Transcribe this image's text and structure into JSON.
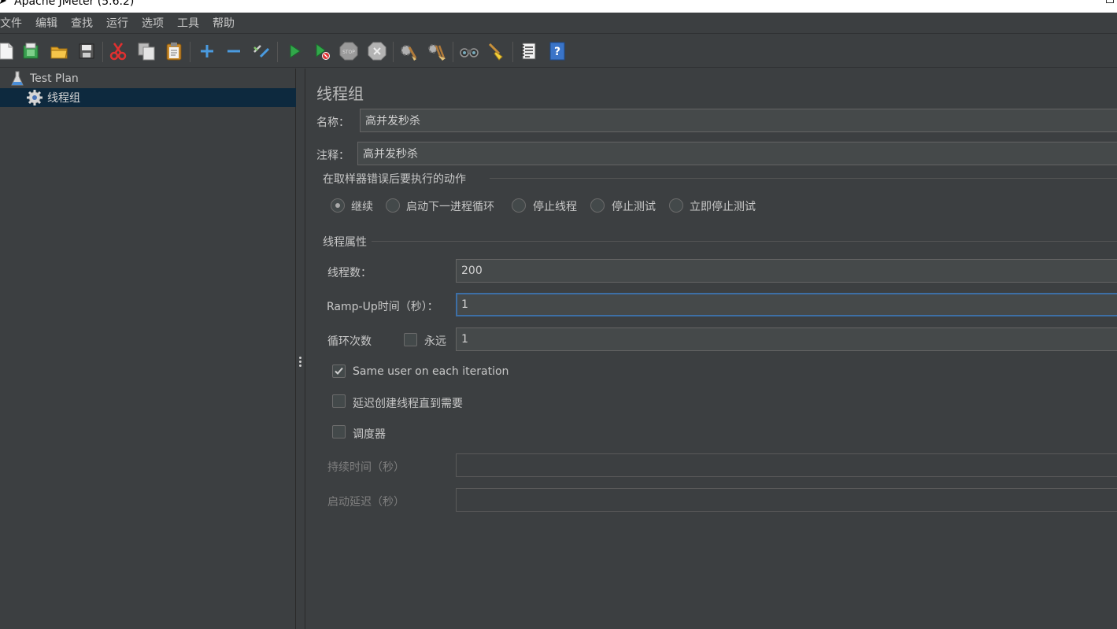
{
  "window": {
    "title": "Apache JMeter (5.6.2)"
  },
  "menu": [
    "文件",
    "编辑",
    "查找",
    "运行",
    "选项",
    "工具",
    "帮助"
  ],
  "toolbar": {
    "icons": [
      "new-icon",
      "templates-icon",
      "open-icon",
      "save-icon",
      "cut-icon",
      "copy-icon",
      "paste-icon",
      "expand-icon",
      "collapse-icon",
      "toggle-icon",
      "start-icon",
      "start-no-pauses-icon",
      "stop-icon",
      "shutdown-icon",
      "clear-icon",
      "clear-all-icon",
      "search-icon",
      "reset-search-icon",
      "function-helper-icon",
      "help-icon"
    ]
  },
  "tree": {
    "root": "Test Plan",
    "child": "线程组"
  },
  "thread_group": {
    "title": "线程组",
    "name_label": "名称：",
    "name_value": "高并发秒杀",
    "comment_label": "注释：",
    "comment_value": "高并发秒杀",
    "error_action": {
      "legend": "在取样器错误后要执行的动作",
      "options": [
        "继续",
        "启动下一进程循环",
        "停止线程",
        "停止测试",
        "立即停止测试"
      ],
      "selected": "继续"
    },
    "properties": {
      "legend": "线程属性",
      "threads_label": "线程数：",
      "threads_value": "200",
      "rampup_label": "Ramp-Up时间（秒）：",
      "rampup_value": "1",
      "loop_label": "循环次数",
      "forever_label": "永远",
      "forever_checked": false,
      "loop_value": "1",
      "same_user_label": "Same user on each iteration",
      "same_user_checked": true,
      "delay_label": "延迟创建线程直到需要",
      "delay_checked": false,
      "scheduler_label": "调度器",
      "scheduler_checked": false,
      "duration_label": "持续时间（秒）",
      "duration_value": "",
      "startup_delay_label": "启动延迟（秒）",
      "startup_delay_value": ""
    }
  },
  "colors": {
    "background": "#3c3f41",
    "selection": "#0d293e",
    "focus": "#3d6fa6"
  }
}
